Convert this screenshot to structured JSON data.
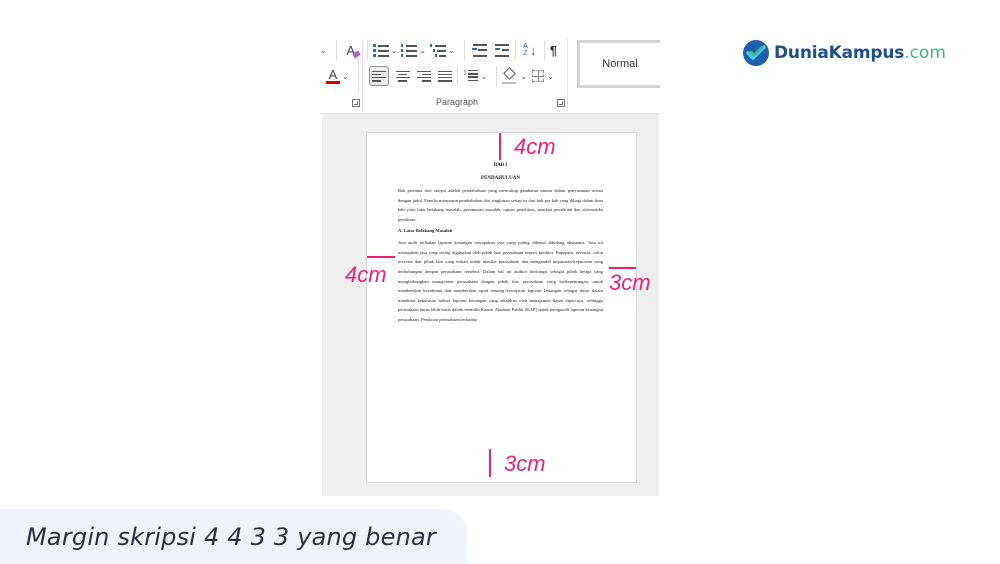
{
  "ribbon": {
    "style_name": "Normal",
    "group_label": "Paragraph",
    "icons": {
      "clear_formatting": "clear-formatting-icon",
      "font_color": "font-color-icon",
      "bullets": "bullets-icon",
      "numbering": "numbering-icon",
      "multilevel": "multilevel-list-icon",
      "decrease_indent": "decrease-indent-icon",
      "increase_indent": "increase-indent-icon",
      "sort": "sort-icon",
      "show_marks": "pilcrow-icon",
      "align_left": "align-left-icon",
      "align_center": "align-center-icon",
      "align_right": "align-right-icon",
      "justify": "justify-icon",
      "line_spacing": "line-spacing-icon",
      "shading": "shading-icon",
      "borders": "borders-icon"
    },
    "pilcrow": "¶",
    "sort_glyph": "A Z↓",
    "clear_glyph": "A",
    "font_color_glyph": "A"
  },
  "document": {
    "chapter": "BAB I",
    "title": "PENDAHULUAN",
    "intro": "Bab pertama dari skripsi adalah pendahuluan yang mencakup gambaran umum dalam penyusunan sesuai dengan judul. Penulis menyusun pembabakan dari ringkasan setiap isi dari bab per bab yang dibagi dalam lima bab yaitu latar belakang masalah, perumusan masalah, tujuan penelitian, manfaat penelitian dan sistematika penulisan.",
    "section_heading": "A. Latar Belakang Masalah",
    "body": "Jasa audit terhadap laporan keuangan merupakan jasa yang paling dikenal dibidang akuntansi. Jasa ini merupakan jasa yang sering digunakan oleh pihak luar perusahaan seperti kreditor, Bapepam, investor, calon investor dan pihak lain yang terkait untuk menilai perusahaan dan mengambil keputusan-keputusan yang berhubungan dengan perusahaan tersebut. Dalam hal ini auditor berfungsi sebagai pihak ketiga yang menghubungkan manajemen perusahaan dengan pihak luar perusahaan yang berkepentingan, untuk memberikan keyakinan dan memberikan opini tentang kewajaran laporan keuangan sebagai dasar dalam membuat keputusan bahwa laporan keuangan yang disajikan oleh manajemen dapat dipercaya, sehingga perusahaan harus lebih kritis dalam memilih Kantor Akuntan Publik (KAP) untuk mengaudit laporan keuangan perusahaan. Penilaian perusahaan terhadap"
  },
  "margins": {
    "top": "4cm",
    "left": "4cm",
    "right": "3cm",
    "bottom": "3cm",
    "color": "#ee1f78"
  },
  "brand": {
    "name": "DuniaKampus",
    "tld": ".com",
    "primary_color": "#1d4f8e",
    "accent_color": "#3cb878"
  },
  "caption": "Margin skripsi 4 4 3 3 yang benar"
}
